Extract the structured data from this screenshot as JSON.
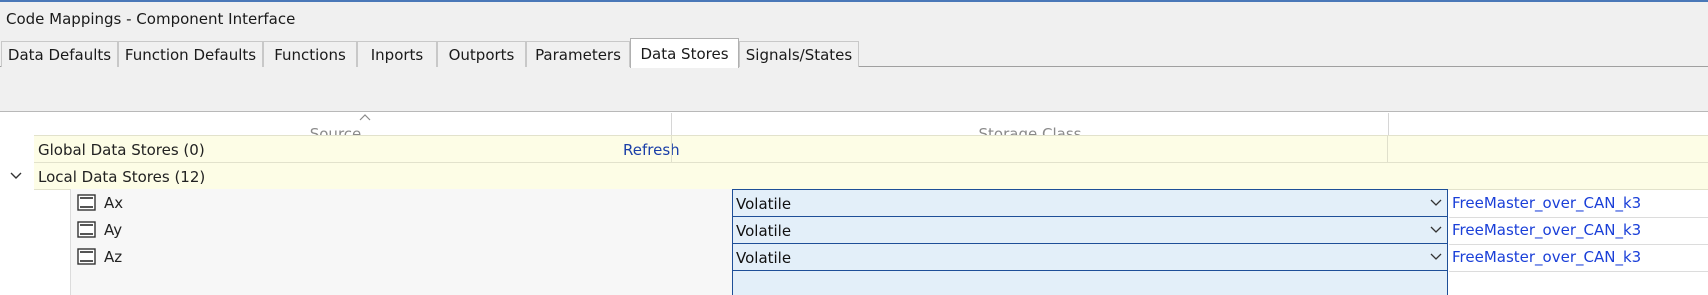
{
  "window": {
    "title": "Code Mappings - Component Interface"
  },
  "tabs": [
    {
      "label": "Data Defaults"
    },
    {
      "label": "Function Defaults"
    },
    {
      "label": "Functions"
    },
    {
      "label": "Inports"
    },
    {
      "label": "Outports"
    },
    {
      "label": "Parameters"
    },
    {
      "label": "Data Stores",
      "active": true
    },
    {
      "label": "Signals/States"
    }
  ],
  "grid": {
    "columns": {
      "source": "Source",
      "storage_class": "Storage Class",
      "third": ""
    },
    "sort_indicator_icon": "sort-ascending-caret",
    "groups": {
      "global": {
        "label": "Global Data Stores (0)",
        "action": "Refresh"
      },
      "local": {
        "label": "Local Data Stores (12)",
        "expanded": true
      }
    },
    "rows": [
      {
        "name": "Ax",
        "storage_class": "Volatile",
        "header_file": "FreeMaster_over_CAN_k3"
      },
      {
        "name": "Ay",
        "storage_class": "Volatile",
        "header_file": "FreeMaster_over_CAN_k3"
      },
      {
        "name": "Az",
        "storage_class": "Volatile",
        "header_file": "FreeMaster_over_CAN_k3"
      }
    ]
  },
  "colors": {
    "accent": "#4a78b8",
    "group_bg": "#fdfde6",
    "selected_cell_bg": "#e3eff9",
    "selected_cell_border": "#1e4f98",
    "link": "#1a3fd8"
  }
}
